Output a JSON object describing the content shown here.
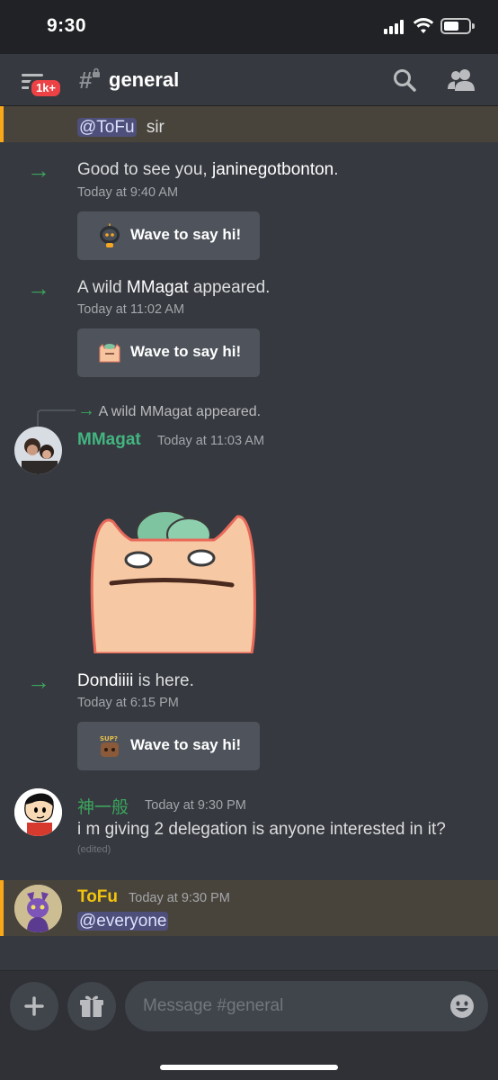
{
  "status_bar": {
    "time": "9:30"
  },
  "header": {
    "badge": "1k+",
    "channel_symbol": "#",
    "channel_name": "general"
  },
  "messages": {
    "tofu_prev": {
      "mention": "@ToFu",
      "text": "sir"
    },
    "join1": {
      "prefix": "Good to see you, ",
      "user": "janinegotbonton",
      "suffix": ".",
      "time": "Today at 9:40 AM",
      "wave_label": "Wave to say hi!"
    },
    "join2": {
      "prefix": "A wild ",
      "user": "MMagat",
      "suffix": " appeared.",
      "time": "Today at 11:02 AM",
      "wave_label": "Wave to say hi!"
    },
    "reply_ref": "A wild MMagat appeared.",
    "mmagat": {
      "author": "MMagat",
      "time": "Today at 11:03 AM",
      "author_color": "#43b581"
    },
    "join3": {
      "user": "Dondiiii",
      "suffix": " is here.",
      "time": "Today at 6:15 PM",
      "wave_label": "Wave to say hi!"
    },
    "shin": {
      "author": "神一般",
      "time": "Today at 9:30 PM",
      "text": "i m giving 2 delegation is anyone interested in it?",
      "edited": "(edited)",
      "author_color": "#3ba55d"
    },
    "tofu": {
      "author": "ToFu",
      "time": "Today at 9:30 PM",
      "mention": "@everyone",
      "author_color": "#f1c40f"
    }
  },
  "composer": {
    "placeholder": "Message #general"
  },
  "colors": {
    "background": "#36393f",
    "header": "#202225",
    "accent_mention": "#faa81a",
    "join_arrow": "#3ba55d"
  }
}
